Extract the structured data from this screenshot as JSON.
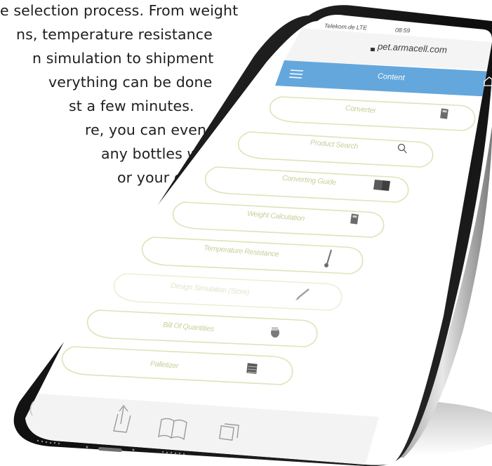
{
  "copy": {
    "lines": [
      "e selection process. From weight",
      "ns, temperature resistance",
      "n simulation to shipment",
      "verything can be done",
      "st a few minutes.",
      "re, you can even find",
      "any bottles were",
      "or your order."
    ]
  },
  "phone": {
    "status_bar": {
      "carrier": "Telekom.de LTE",
      "time": "08:59"
    },
    "address_bar": {
      "url": "pet.armacell.com"
    },
    "header": {
      "title": "Content"
    },
    "menu_items": [
      {
        "label": "Converter",
        "icon": "calculator-icon"
      },
      {
        "label": "Product Search",
        "icon": "search-icon"
      },
      {
        "label": "Converting Guide",
        "icon": "book-icon"
      },
      {
        "label": "Weight Calculation",
        "icon": "calculator-icon"
      },
      {
        "label": "Temperature Resistance",
        "icon": "thermometer-icon"
      },
      {
        "label": "Design Simulation (Store)",
        "icon": "pencil-icon"
      },
      {
        "label": "Bill Of Quantities",
        "icon": "bottles-icon"
      },
      {
        "label": "Palletizer",
        "icon": "pallet-icon"
      }
    ],
    "colors": {
      "header_bar": "#64a7dc",
      "menu_text": "#c9cf9a",
      "menu_border": "#dfe3b8",
      "screen_bg": "#ffffff",
      "frame": "#1b1b1b"
    }
  }
}
